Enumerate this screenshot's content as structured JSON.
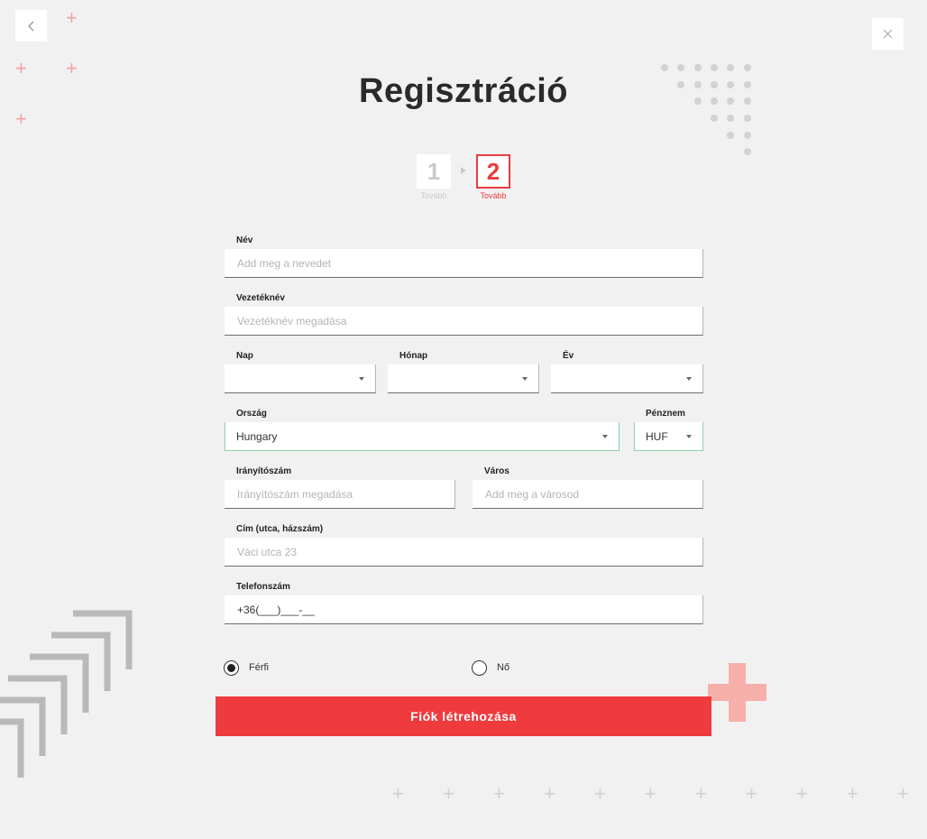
{
  "header": {
    "title": "Regisztráció",
    "back_icon": "chevron-left-icon",
    "close_icon": "close-icon"
  },
  "steps": [
    {
      "number": "1",
      "label": "Tovább"
    },
    {
      "number": "2",
      "label": "Tovább"
    }
  ],
  "form": {
    "name": {
      "label": "Név",
      "placeholder": "Add meg a nevedet"
    },
    "surname": {
      "label": "Vezetéknév",
      "placeholder": "Vezetéknév megadása"
    },
    "day": {
      "label": "Nap",
      "value": ""
    },
    "month": {
      "label": "Hónap",
      "value": ""
    },
    "year": {
      "label": "Év",
      "value": ""
    },
    "country": {
      "label": "Ország",
      "value": "Hungary"
    },
    "currency": {
      "label": "Pénznem",
      "value": "HUF"
    },
    "zip": {
      "label": "Irányítószám",
      "placeholder": "Irányítószám megadása"
    },
    "city": {
      "label": "Város",
      "placeholder": "Add meg a városod"
    },
    "address": {
      "label": "Cím (utca, házszám)",
      "placeholder": "Váci utca 23"
    },
    "phone": {
      "label": "Telefonszám",
      "value": "+36(___)___-__"
    },
    "gender": {
      "male": "Férfi",
      "female": "Nő",
      "selected": "male"
    },
    "submit_label": "Fiók létrehozása"
  },
  "colors": {
    "accent": "#ef3a3e",
    "background": "#f1f1f1",
    "valid_border": "#8fd0a9"
  }
}
